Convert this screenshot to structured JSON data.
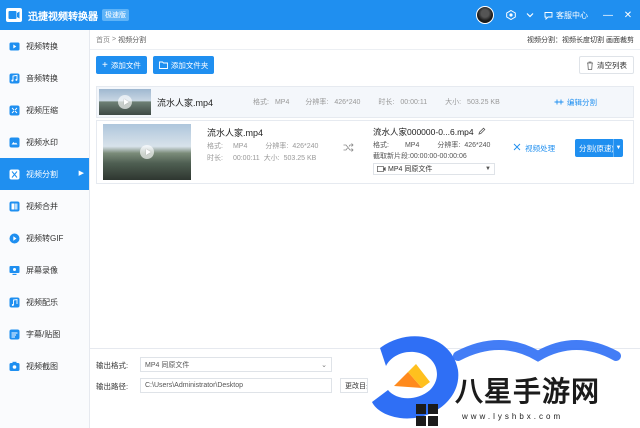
{
  "titlebar": {
    "title": "迅捷视频转换器",
    "edition": "极速版",
    "service_label": "客服中心",
    "window_min": "—",
    "window_close": "✕"
  },
  "sidebar": {
    "items": [
      {
        "label": "视频转换",
        "icon": "video-convert-icon"
      },
      {
        "label": "音频转换",
        "icon": "audio-convert-icon"
      },
      {
        "label": "视频压缩",
        "icon": "video-compress-icon"
      },
      {
        "label": "视频水印",
        "icon": "video-watermark-icon"
      },
      {
        "label": "视频分割",
        "icon": "video-split-icon",
        "active": true
      },
      {
        "label": "视频合并",
        "icon": "video-merge-icon"
      },
      {
        "label": "视频转GIF",
        "icon": "video-gif-icon"
      },
      {
        "label": "屏幕录像",
        "icon": "screen-record-icon"
      },
      {
        "label": "视频配乐",
        "icon": "video-music-icon"
      },
      {
        "label": "字幕/贴图",
        "icon": "subtitle-sticker-icon"
      },
      {
        "label": "视频截图",
        "icon": "video-screenshot-icon"
      }
    ]
  },
  "breadcrumb": {
    "home": "首页",
    "sep": ">",
    "current": "视频分割",
    "right_text": "视频分割：视频长度切割 画面裁剪"
  },
  "toolbar": {
    "add_file": "添加文件",
    "add_folder": "添加文件夹",
    "clear_list": "清空列表"
  },
  "file_list": {
    "row1": {
      "name": "流水人家.mp4",
      "format_label": "格式:",
      "format": "MP4",
      "resolution_label": "分辨率:",
      "resolution": "426*240",
      "duration_label": "时长:",
      "duration": "00:00:11",
      "size_label": "大小:",
      "size": "503.25 KB",
      "edit_split": "编辑分割"
    },
    "row2": {
      "name": "流水人家.mp4",
      "format_label": "格式:",
      "format": "MP4",
      "resolution_label": "分辨率:",
      "resolution": "426*240",
      "duration_label": "时长:",
      "duration": "00:00:11",
      "size_label": "大小:",
      "size": "503.25 KB",
      "output_name": "流水人家000000-0...6.mp4",
      "out_format_label": "格式:",
      "out_format": "MP4",
      "out_resolution_label": "分辨率:",
      "out_resolution": "426*240",
      "cut_label": "截取新片段:",
      "cut_range": "00:00:00-00:00:06",
      "out_select": "MP4  同原文件",
      "video_process": "视频处理",
      "split_button": "分割(原速)"
    }
  },
  "bottom": {
    "format_label": "输出格式:",
    "format_value": "MP4  同原文件",
    "path_label": "输出路径:",
    "path_value": "C:\\Users\\Administrator\\Desktop",
    "change_button": "更改目录"
  },
  "watermark": {
    "text": "八星手游网",
    "url": "www.lyshbx.com"
  }
}
